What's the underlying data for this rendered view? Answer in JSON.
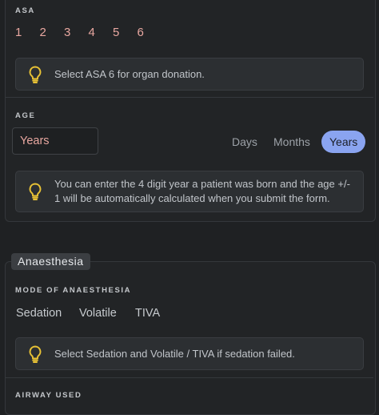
{
  "patient": {
    "asa": {
      "label": "ASA",
      "options": [
        "1",
        "2",
        "3",
        "4",
        "5",
        "6"
      ],
      "hint": "Select ASA 6 for organ donation."
    },
    "age": {
      "label": "AGE",
      "input_value": "Years",
      "units": [
        "Days",
        "Months",
        "Years"
      ],
      "selected_unit": "Years",
      "hint": "You can enter the 4 digit year a patient was born and the age +/- 1 will be automatically calculated when you submit the form."
    }
  },
  "anaesthesia": {
    "title": "Anaesthesia",
    "mode": {
      "label": "MODE OF ANAESTHESIA",
      "options": [
        "Sedation",
        "Volatile",
        "TIVA"
      ],
      "hint": "Select Sedation and Volatile / TIVA if sedation failed."
    },
    "airway_label": "AIRWAY USED"
  },
  "colors": {
    "accent": "#8aa4f0",
    "asa_number": "#e8a7a0",
    "bulb": "#e8c235"
  },
  "icons": {
    "hint": "lightbulb-icon"
  }
}
